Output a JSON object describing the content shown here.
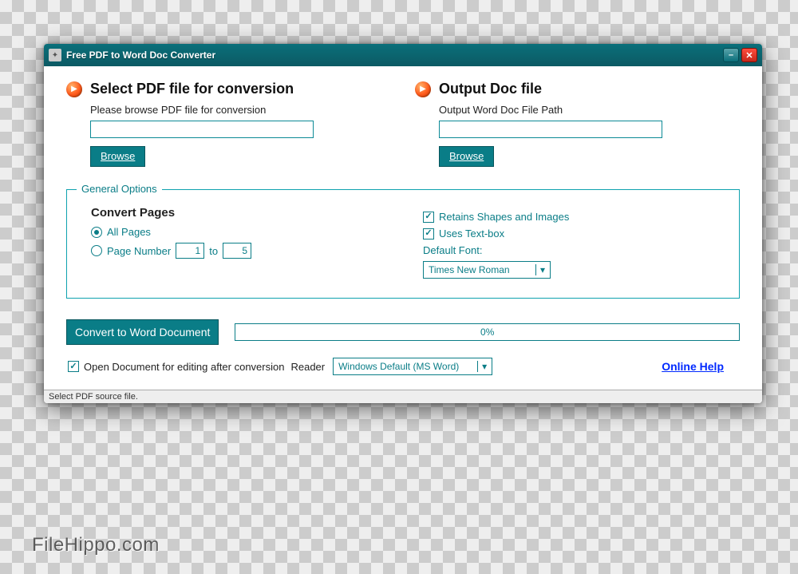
{
  "titlebar": {
    "title": "Free PDF to Word Doc Converter"
  },
  "input_section": {
    "title": "Select PDF file for conversion",
    "subtitle": "Please browse PDF file for conversion",
    "path_value": "",
    "browse_label": "Browse"
  },
  "output_section": {
    "title": "Output Doc file",
    "subtitle": "Output Word Doc File Path",
    "path_value": "",
    "browse_label": "Browse"
  },
  "options": {
    "legend": "General Options",
    "convert_pages_label": "Convert Pages",
    "all_pages_label": "All Pages",
    "page_number_label": "Page Number",
    "page_from": "1",
    "page_to_label": "to",
    "page_to": "5",
    "retain_shapes_label": "Retains Shapes and Images",
    "uses_textbox_label": "Uses Text-box",
    "default_font_label": "Default Font:",
    "default_font_value": "Times New Roman"
  },
  "actions": {
    "convert_label": "Convert to Word Document",
    "progress_text": "0%"
  },
  "bottom": {
    "open_after_label": "Open Document for editing after conversion",
    "reader_label": "Reader",
    "reader_value": "Windows Default (MS Word)",
    "help_label": "Online Help"
  },
  "statusbar": {
    "text": "Select PDF source file."
  },
  "watermark": "FileHippo.com"
}
